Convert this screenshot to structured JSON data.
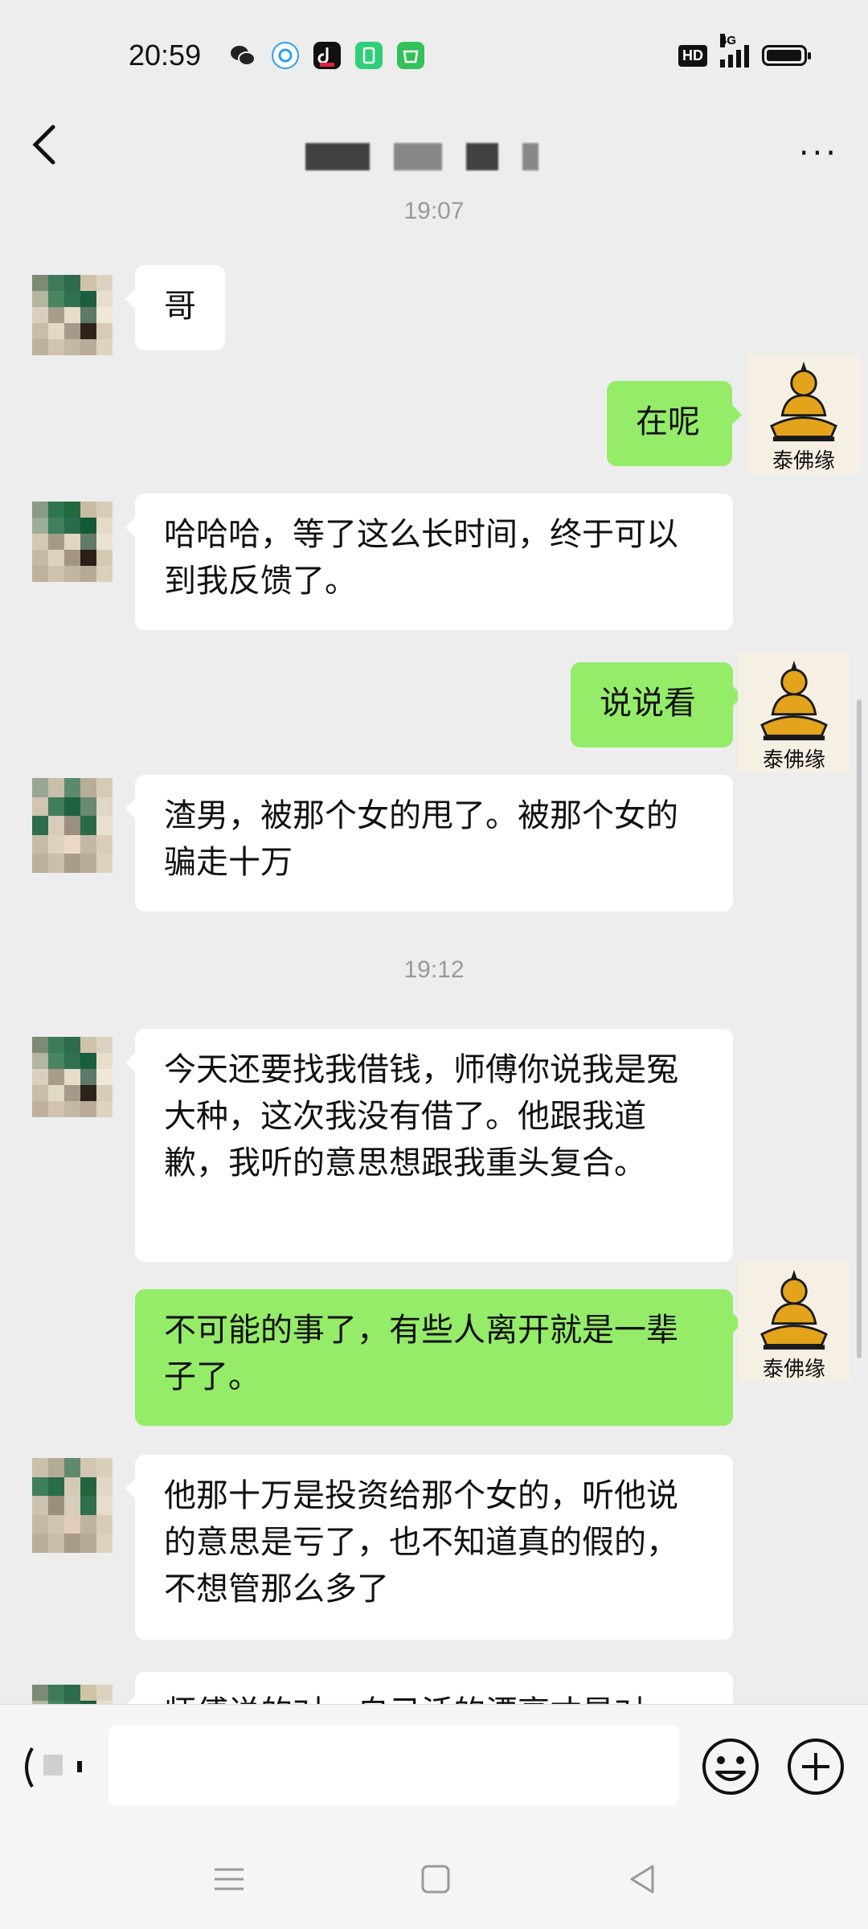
{
  "status_bar": {
    "time": "20:59",
    "hd": "HD",
    "network": "4G",
    "battery_level": 0.85,
    "app_icons": [
      {
        "name": "wechat-icon",
        "color": "#222222"
      },
      {
        "name": "qq-browser-icon",
        "color": "#2aa0f0"
      },
      {
        "name": "douyin-icon",
        "color": "#111111"
      },
      {
        "name": "battery-app-icon",
        "color": "#2fcf7a"
      },
      {
        "name": "shopping-app-icon",
        "color": "#33c15a"
      }
    ]
  },
  "header": {
    "back_icon": "chevron-left-icon",
    "more_icon": "more-icon",
    "more_label": "···"
  },
  "chat": {
    "timestamps": [
      "19:07",
      "19:12"
    ],
    "messages": [
      {
        "side": "in",
        "text": "哥"
      },
      {
        "side": "out",
        "text": "在呢"
      },
      {
        "side": "in",
        "text": "哈哈哈，等了这么长时间，终于可以到我反馈了。"
      },
      {
        "side": "out",
        "text": "说说看"
      },
      {
        "side": "in",
        "text": "渣男，被那个女的甩了。被那个女的骗走十万"
      },
      {
        "side": "in",
        "text": "今天还要找我借钱，师傅你说我是冤大种，这次我没有借了。他跟我道歉，我听的意思想跟我重头复合。"
      },
      {
        "side": "out",
        "text": "不可能的事了，有些人离开就是一辈子了。"
      },
      {
        "side": "in",
        "text": "他那十万是投资给那个女的，听他说的意思是亏了，也不知道真的假的，不想管那么多了"
      },
      {
        "side": "in",
        "text": "师傅说的对，自己活的漂亮才是对"
      }
    ],
    "my_avatar_caption": "泰佛缘"
  },
  "input_bar": {
    "message_value": "",
    "voice_icon": "voice-icon",
    "emoji_icon": "emoji-icon",
    "plus_icon": "plus-icon"
  },
  "nav_bar": {
    "menu_icon": "menu-icon",
    "home_icon": "home-icon",
    "back_icon": "back-triangle-icon"
  }
}
